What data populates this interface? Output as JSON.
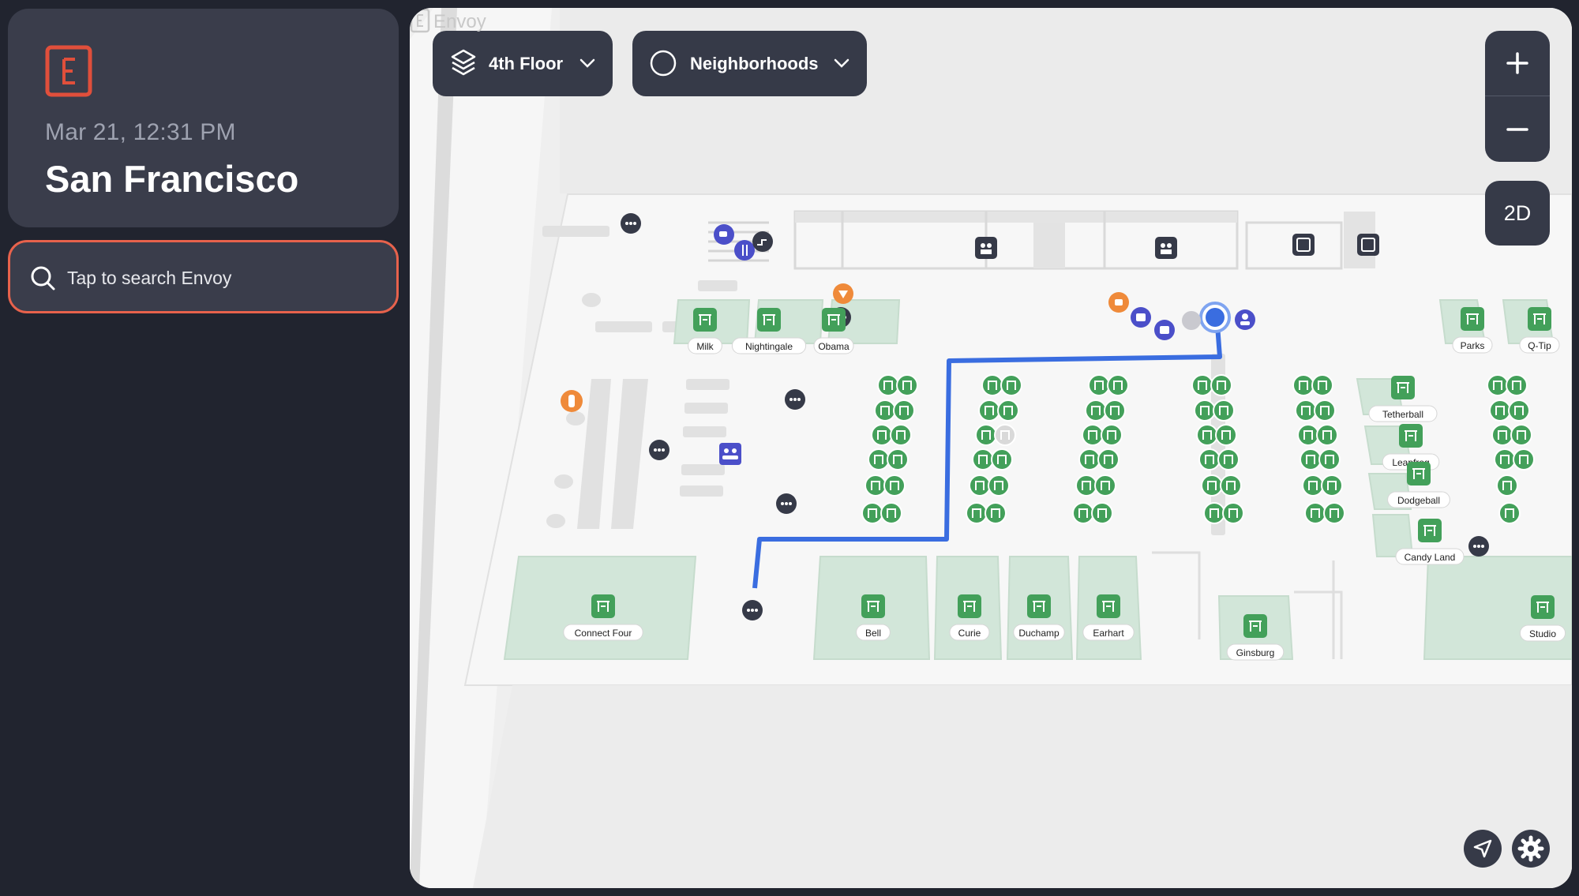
{
  "sidebar": {
    "logo_icon": "envoy-logo-icon",
    "datetime": "Mar 21, 12:31 PM",
    "location": "San Francisco",
    "search_placeholder": "Tap to search Envoy"
  },
  "map": {
    "floor_selector": {
      "label": "4th Floor",
      "icon": "layers-icon"
    },
    "neighborhood_selector": {
      "label": "Neighborhoods",
      "icon": "circle-icon"
    },
    "zoom_in": "+",
    "zoom_out": "−",
    "view_mode": "2D",
    "watermark": "Envoy",
    "rooms": [
      {
        "name": "Milk"
      },
      {
        "name": "Nightingale"
      },
      {
        "name": "Obama"
      },
      {
        "name": "Parks"
      },
      {
        "name": "Q-Tip"
      },
      {
        "name": "Tetherball"
      },
      {
        "name": "Leapfrog"
      },
      {
        "name": "Dodgeball"
      },
      {
        "name": "Candy Land"
      },
      {
        "name": "Connect Four"
      },
      {
        "name": "Bell"
      },
      {
        "name": "Curie"
      },
      {
        "name": "Duchamp"
      },
      {
        "name": "Earhart"
      },
      {
        "name": "Ginsburg"
      },
      {
        "name": "Studio"
      }
    ],
    "colors": {
      "route": "#3a6de0",
      "room": "#d2e6d9",
      "desk": "#43a05a",
      "amenity": "#4b4fc9",
      "safety": "#ef8a3a"
    }
  }
}
